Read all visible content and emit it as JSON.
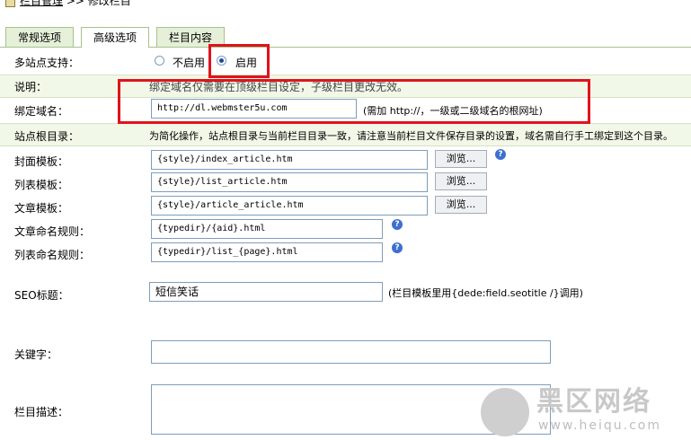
{
  "breadcrumb": {
    "text_link": "栏目管理",
    "text_rest": " >> 修改栏目"
  },
  "tabs": [
    "常规选项",
    "高级选项",
    "栏目内容"
  ],
  "multisite": {
    "label": "多站点支持：",
    "options": [
      "不启用",
      "启用"
    ],
    "selected": "启用"
  },
  "desc": {
    "label": "说明：",
    "text": "绑定域名仅需要在顶级栏目设定，子级栏目更改无效。"
  },
  "domain": {
    "label": "绑定域名：",
    "value": "http://dl.webmster5u.com",
    "note": "(需加 http://，一级或二级域名的根网址)"
  },
  "siteroot": {
    "label": "站点根目录：",
    "text": "为简化操作，站点根目录与当前栏目目录一致，请注意当前栏目文件保存目录的设置，域名需自行手工绑定到这个目录。"
  },
  "templates": [
    {
      "label": "封面模板：",
      "value": "{style}/index_article.htm",
      "button": "浏览..."
    },
    {
      "label": "列表模板：",
      "value": "{style}/list_article.htm",
      "button": "浏览..."
    },
    {
      "label": "文章模板：",
      "value": "{style}/article_article.htm",
      "button": "浏览..."
    }
  ],
  "naming": [
    {
      "label": "文章命名规则：",
      "value": "{typedir}/{aid}.html"
    },
    {
      "label": "列表命名规则：",
      "value": "{typedir}/list_{page}.html"
    }
  ],
  "seo": {
    "label": "SEO标题：",
    "value": "短信笑话",
    "note": "(栏目模板里用{dede:field.seotitle /}调用)"
  },
  "keywords": {
    "label": "关键字："
  },
  "description": {
    "label": "栏目描述："
  },
  "help_glyph": "?",
  "watermark": {
    "cn": "黑区网络",
    "url": "www.heiqu.com"
  },
  "colors": {
    "tab_bg": "#e6f0d8",
    "tab_border": "#a7c28a",
    "highlight": "#e0131c"
  }
}
